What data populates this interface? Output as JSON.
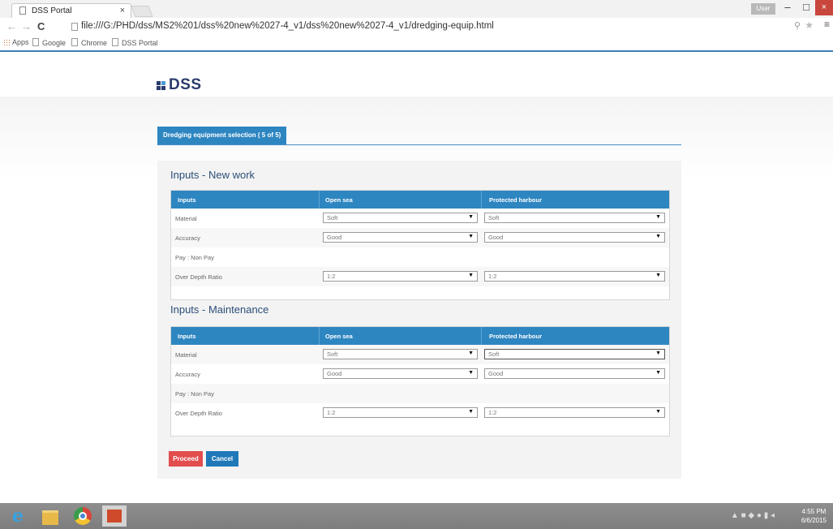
{
  "browser": {
    "tab_title": "DSS Portal",
    "tab_close": "×",
    "user_badge": "User",
    "win_min": "–",
    "win_max": "□",
    "win_close": "×",
    "nav_back": "←",
    "nav_forward": "→",
    "nav_reload": "C",
    "url": "file:///G:/PHD/dss/MS2%201/dss%20new%2027-4_v1/dss%20new%2027-4_v1/dredging-equip.html",
    "menu_glyph": "≡",
    "bookmarks": [
      "Apps",
      "Google",
      "Chrome",
      "DSS Portal"
    ]
  },
  "page": {
    "logo_text": "DSS",
    "tab_label": "Dredging equipment selection ( 5 of 5)",
    "sections": [
      {
        "title": "Inputs - New work",
        "headers": [
          "Inputs",
          "Open sea",
          "Protected harbour"
        ],
        "rows": [
          {
            "label": "Material",
            "open_sea": "Soft",
            "harbour": "Soft"
          },
          {
            "label": "Accuracy",
            "open_sea": "Good",
            "harbour": "Good"
          },
          {
            "label": "Pay : Non Pay",
            "open_sea": "",
            "harbour": ""
          },
          {
            "label": "Over Depth Ratio",
            "open_sea": "1:2",
            "harbour": "1:2"
          }
        ]
      },
      {
        "title": "Inputs - Maintenance",
        "headers": [
          "Inputs",
          "Open sea",
          "Protected harbour"
        ],
        "rows": [
          {
            "label": "Material",
            "open_sea": "Soft",
            "harbour": "Soft"
          },
          {
            "label": "Accuracy",
            "open_sea": "Good",
            "harbour": "Good"
          },
          {
            "label": "Pay : Non Pay",
            "open_sea": "",
            "harbour": ""
          },
          {
            "label": "Over Depth Ratio",
            "open_sea": "1:2",
            "harbour": "1:2"
          }
        ]
      }
    ],
    "buttons": {
      "proceed": "Proceed",
      "cancel": "Cancel"
    }
  },
  "taskbar": {
    "time": "4:55 PM",
    "date": "6/6/2015"
  },
  "colors": {
    "accent": "#2e86c1",
    "proceed": "#e24d4d",
    "cancel": "#1f78b8",
    "logo": "#2a3b6b"
  }
}
